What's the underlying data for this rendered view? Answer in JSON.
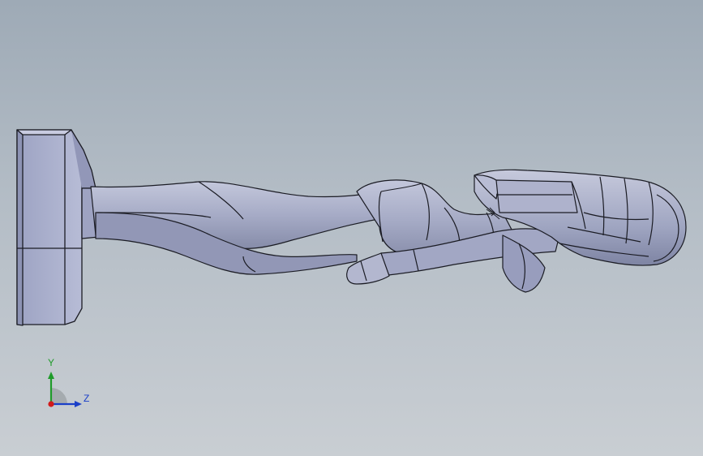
{
  "viewport": {
    "background_top": "#9eaab6",
    "background_bottom": "#c9ced3",
    "model_color": "#a9aec7",
    "edge_color": "#1b1c24"
  },
  "model": {
    "name_icon": "figurine-on-pedestal-icon",
    "orientation": "lying-side-view"
  },
  "triad": {
    "y_label": "Y",
    "z_label": "Z",
    "y_color": "#1f9b2a",
    "z_color": "#1a3fc8",
    "x_color": "#d11a1a"
  }
}
